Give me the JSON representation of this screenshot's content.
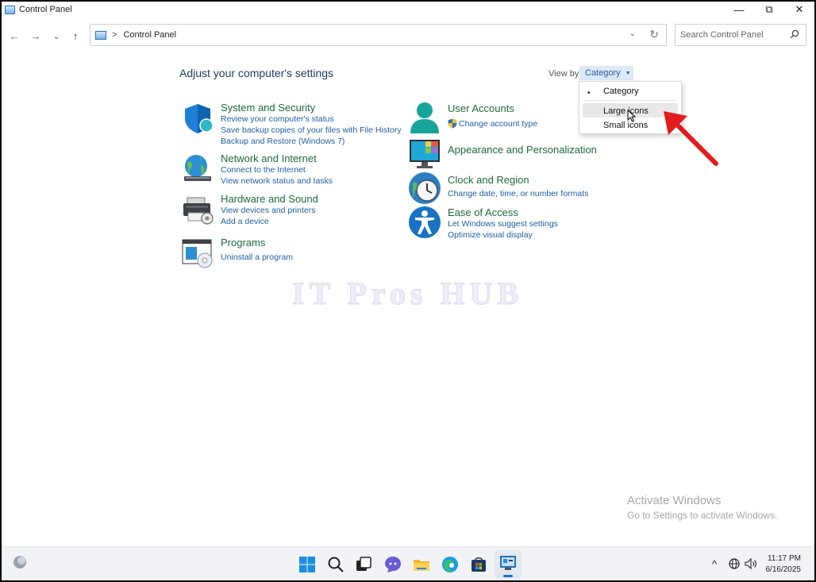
{
  "window": {
    "title": "Control Panel",
    "minimize": "—",
    "restore": "⧉",
    "close": "✕"
  },
  "nav": {
    "back": "←",
    "forward": "→",
    "recent": "⌄",
    "up": "↑",
    "address_sep": ">",
    "address": "Control Panel",
    "address_dropdown": "⌄",
    "refresh": "↻",
    "search_placeholder": "Search Control Panel"
  },
  "main": {
    "heading": "Adjust your computer's settings",
    "view_by_label": "View by:",
    "view_by_value": "Category",
    "view_by_caret": "▼"
  },
  "categories": [
    {
      "title": "System and Security",
      "links": [
        "Review your computer's status",
        "Save backup copies of your files with File History",
        "Backup and Restore (Windows 7)"
      ]
    },
    {
      "title": "Network and Internet",
      "links": [
        "Connect to the Internet",
        "View network status and tasks"
      ]
    },
    {
      "title": "Hardware and Sound",
      "links": [
        "View devices and printers",
        "Add a device"
      ]
    },
    {
      "title": "Programs",
      "links": [
        "Uninstall a program"
      ]
    },
    {
      "title": "User Accounts",
      "links": [
        "Change account type"
      ]
    },
    {
      "title": "Appearance and Personalization",
      "links": []
    },
    {
      "title": "Clock and Region",
      "links": [
        "Change date, time, or number formats"
      ]
    },
    {
      "title": "Ease of Access",
      "links": [
        "Let Windows suggest settings",
        "Optimize visual display"
      ]
    }
  ],
  "view_menu": {
    "selected_bullet": "•",
    "items": [
      "Category",
      "Large icons",
      "Small icons"
    ],
    "selected": "Category",
    "hovered": "Large icons"
  },
  "watermark": "IT Pros HUB",
  "activation": {
    "line1": "Activate Windows",
    "line2": "Go to Settings to activate Windows."
  },
  "taskbar": {
    "apps": [
      "start-icon",
      "search-icon",
      "task-view-icon",
      "chat-icon",
      "file-explorer-icon",
      "edge-icon",
      "store-icon",
      "control-panel-icon"
    ],
    "time": "11:17 PM",
    "date": "6/16/2025",
    "tray_chevron": "^",
    "speaker": "🔊"
  },
  "colors": {
    "category_title": "#1c6b3a",
    "link": "#1f5fa8",
    "arrow": "#e21b1b",
    "selection": "#dbe9f8"
  }
}
